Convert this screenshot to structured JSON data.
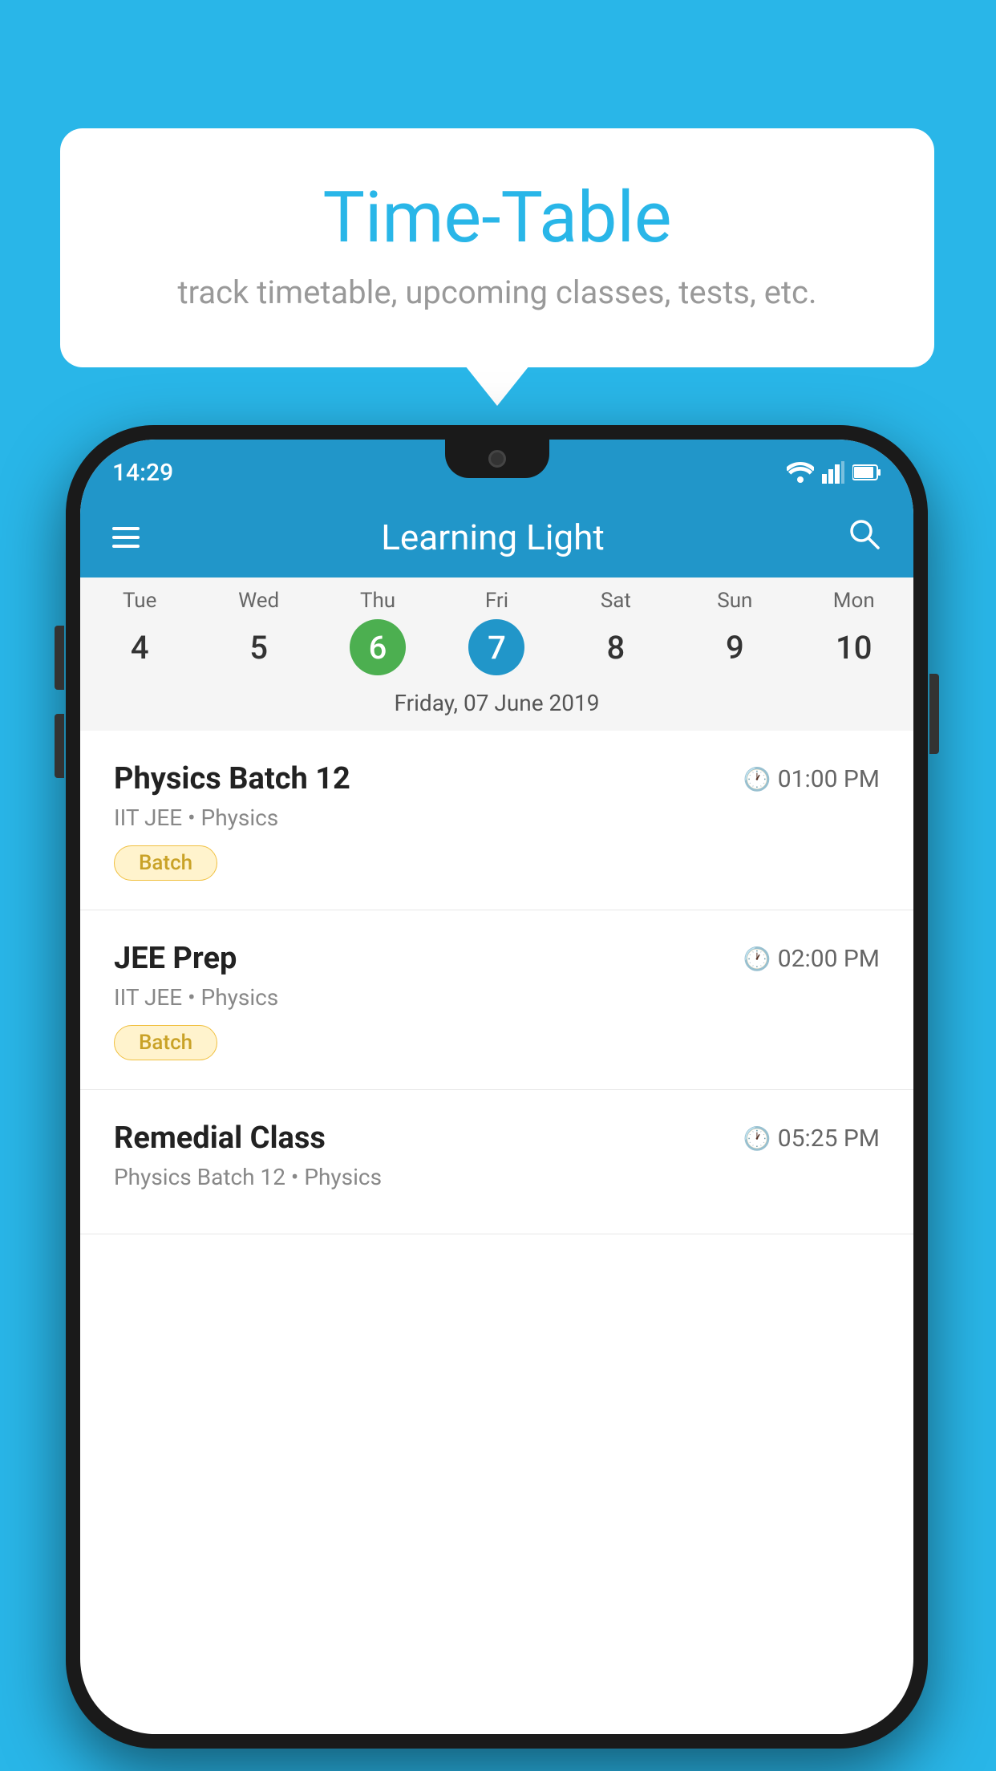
{
  "background_color": "#29b6e8",
  "tooltip": {
    "title": "Time-Table",
    "subtitle": "track timetable, upcoming classes, tests, etc."
  },
  "phone": {
    "status_bar": {
      "time": "14:29"
    },
    "app_header": {
      "title": "Learning Light"
    },
    "calendar": {
      "days": [
        {
          "name": "Tue",
          "num": "4",
          "state": "normal"
        },
        {
          "name": "Wed",
          "num": "5",
          "state": "normal"
        },
        {
          "name": "Thu",
          "num": "6",
          "state": "today"
        },
        {
          "name": "Fri",
          "num": "7",
          "state": "selected"
        },
        {
          "name": "Sat",
          "num": "8",
          "state": "normal"
        },
        {
          "name": "Sun",
          "num": "9",
          "state": "normal"
        },
        {
          "name": "Mon",
          "num": "10",
          "state": "normal"
        }
      ],
      "selected_date_label": "Friday, 07 June 2019"
    },
    "schedule": [
      {
        "name": "Physics Batch 12",
        "time": "01:00 PM",
        "sub": "IIT JEE • Physics",
        "badge": "Batch"
      },
      {
        "name": "JEE Prep",
        "time": "02:00 PM",
        "sub": "IIT JEE • Physics",
        "badge": "Batch"
      },
      {
        "name": "Remedial Class",
        "time": "05:25 PM",
        "sub": "Physics Batch 12 • Physics",
        "badge": null
      }
    ]
  }
}
